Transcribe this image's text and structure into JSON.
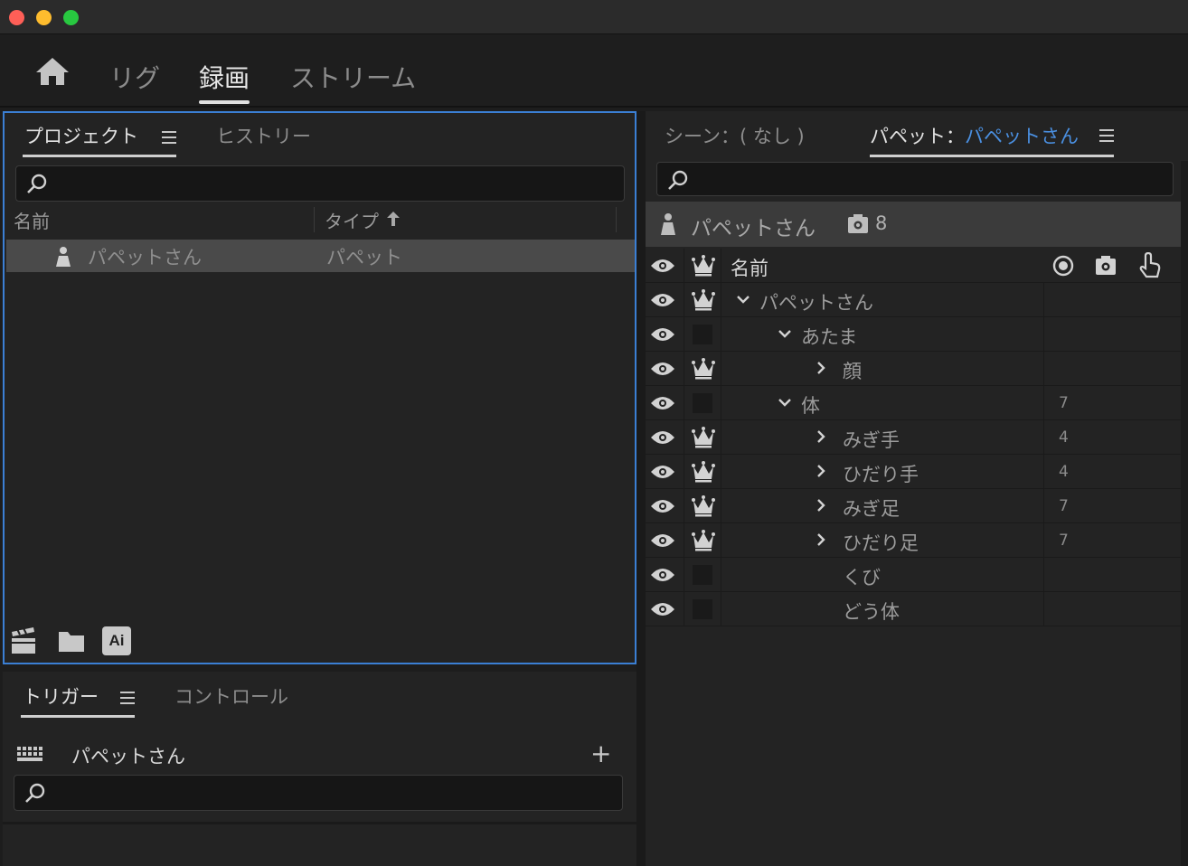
{
  "window": {
    "controls": [
      "close",
      "minimize",
      "zoom"
    ]
  },
  "modes": {
    "home_icon": "home-icon",
    "tabs": [
      "リグ",
      "録画",
      "ストリーム"
    ],
    "active": "録画"
  },
  "project_panel": {
    "tabs": [
      "プロジェクト",
      "ヒストリー"
    ],
    "search_placeholder": "",
    "columns": {
      "name": "名前",
      "type": "タイプ",
      "sort_icon": "arrow-up-icon"
    },
    "rows": [
      {
        "name": "パペットさん",
        "type": "パペット",
        "icon": "puppet-icon"
      }
    ],
    "bottom_icons": [
      "scene-icon",
      "folder-icon",
      "Ai"
    ]
  },
  "trigger_panel": {
    "tabs": [
      "トリガー",
      "コントロール"
    ],
    "puppet": "パペットさん",
    "search_placeholder": ""
  },
  "puppet_panel": {
    "scene_tab": "シーン：( なし )",
    "puppet_label": "パペット：",
    "puppet_value": "パペットさん",
    "search_placeholder": "",
    "header": {
      "name": "パペットさん",
      "behavior_count": "8"
    },
    "tree_header": {
      "name": "名前"
    },
    "tree": [
      {
        "name": "パペットさん",
        "level": 0,
        "crown": true,
        "expanded": true,
        "count": ""
      },
      {
        "name": "あたま",
        "level": 1,
        "crown": false,
        "expanded": true,
        "count": ""
      },
      {
        "name": "顔",
        "level": 2,
        "crown": true,
        "expanded": false,
        "count": ""
      },
      {
        "name": "体",
        "level": 1,
        "crown": false,
        "expanded": true,
        "count": "7"
      },
      {
        "name": "みぎ手",
        "level": 2,
        "crown": true,
        "expanded": false,
        "count": "4"
      },
      {
        "name": "ひだり手",
        "level": 2,
        "crown": true,
        "expanded": false,
        "count": "4"
      },
      {
        "name": "みぎ足",
        "level": 2,
        "crown": true,
        "expanded": false,
        "count": "7"
      },
      {
        "name": "ひだり足",
        "level": 2,
        "crown": true,
        "expanded": false,
        "count": "7"
      },
      {
        "name": "くび",
        "level": 2,
        "crown": false,
        "leaf": true,
        "count": ""
      },
      {
        "name": "どう体",
        "level": 2,
        "crown": false,
        "leaf": true,
        "count": ""
      }
    ]
  },
  "colors": {
    "accent": "#3b7fd4",
    "puppet_link": "#4a8fe0",
    "background": "#232323"
  }
}
